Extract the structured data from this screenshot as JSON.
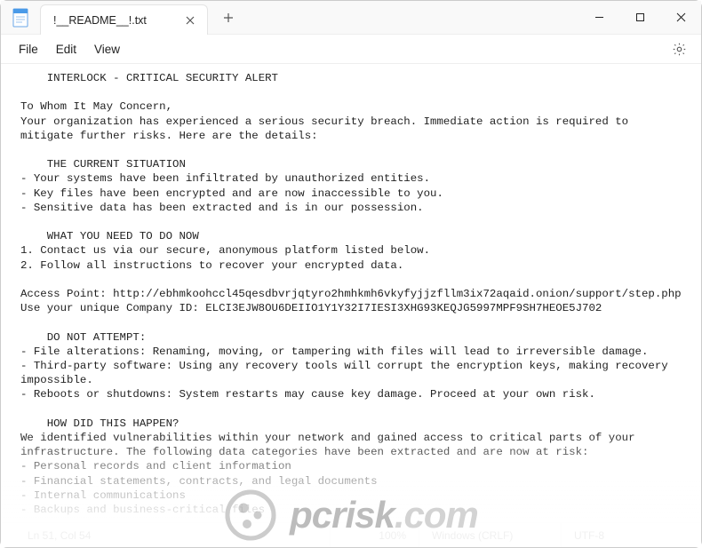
{
  "tab": {
    "title": "!__README__!.txt"
  },
  "menubar": {
    "file": "File",
    "edit": "Edit",
    "view": "View"
  },
  "document": {
    "text": "    INTERLOCK - CRITICAL SECURITY ALERT\n\nTo Whom It May Concern,\nYour organization has experienced a serious security breach. Immediate action is required to mitigate further risks. Here are the details:\n\n    THE CURRENT SITUATION\n- Your systems have been infiltrated by unauthorized entities.\n- Key files have been encrypted and are now inaccessible to you.\n- Sensitive data has been extracted and is in our possession.\n\n    WHAT YOU NEED TO DO NOW\n1. Contact us via our secure, anonymous platform listed below.\n2. Follow all instructions to recover your encrypted data.\n\nAccess Point: http://ebhmkoohccl45qesdbvrjqtyro2hmhkmh6vkyfyjjzfllm3ix72aqaid.onion/support/step.php\nUse your unique Company ID: ELCI3EJW8OU6DEIIO1Y1Y32I7IESI3XHG93KEQJG5997MPF9SH7HEOE5J702\n\n    DO NOT ATTEMPT:\n- File alterations: Renaming, moving, or tampering with files will lead to irreversible damage.\n- Third-party software: Using any recovery tools will corrupt the encryption keys, making recovery impossible.\n- Reboots or shutdowns: System restarts may cause key damage. Proceed at your own risk.\n\n    HOW DID THIS HAPPEN?\nWe identified vulnerabilities within your network and gained access to critical parts of your infrastructure. The following data categories have been extracted and are now at risk:\n- Personal records and client information\n- Financial statements, contracts, and legal documents\n- Internal communications\n- Backups and business-critical files"
  },
  "statusbar": {
    "position": "Ln 51, Col 54",
    "zoom": "100%",
    "eol": "Windows (CRLF)",
    "encoding": "UTF-8"
  },
  "watermark": {
    "brand_left": "pc",
    "brand_right": "risk",
    "tld": ".com"
  }
}
